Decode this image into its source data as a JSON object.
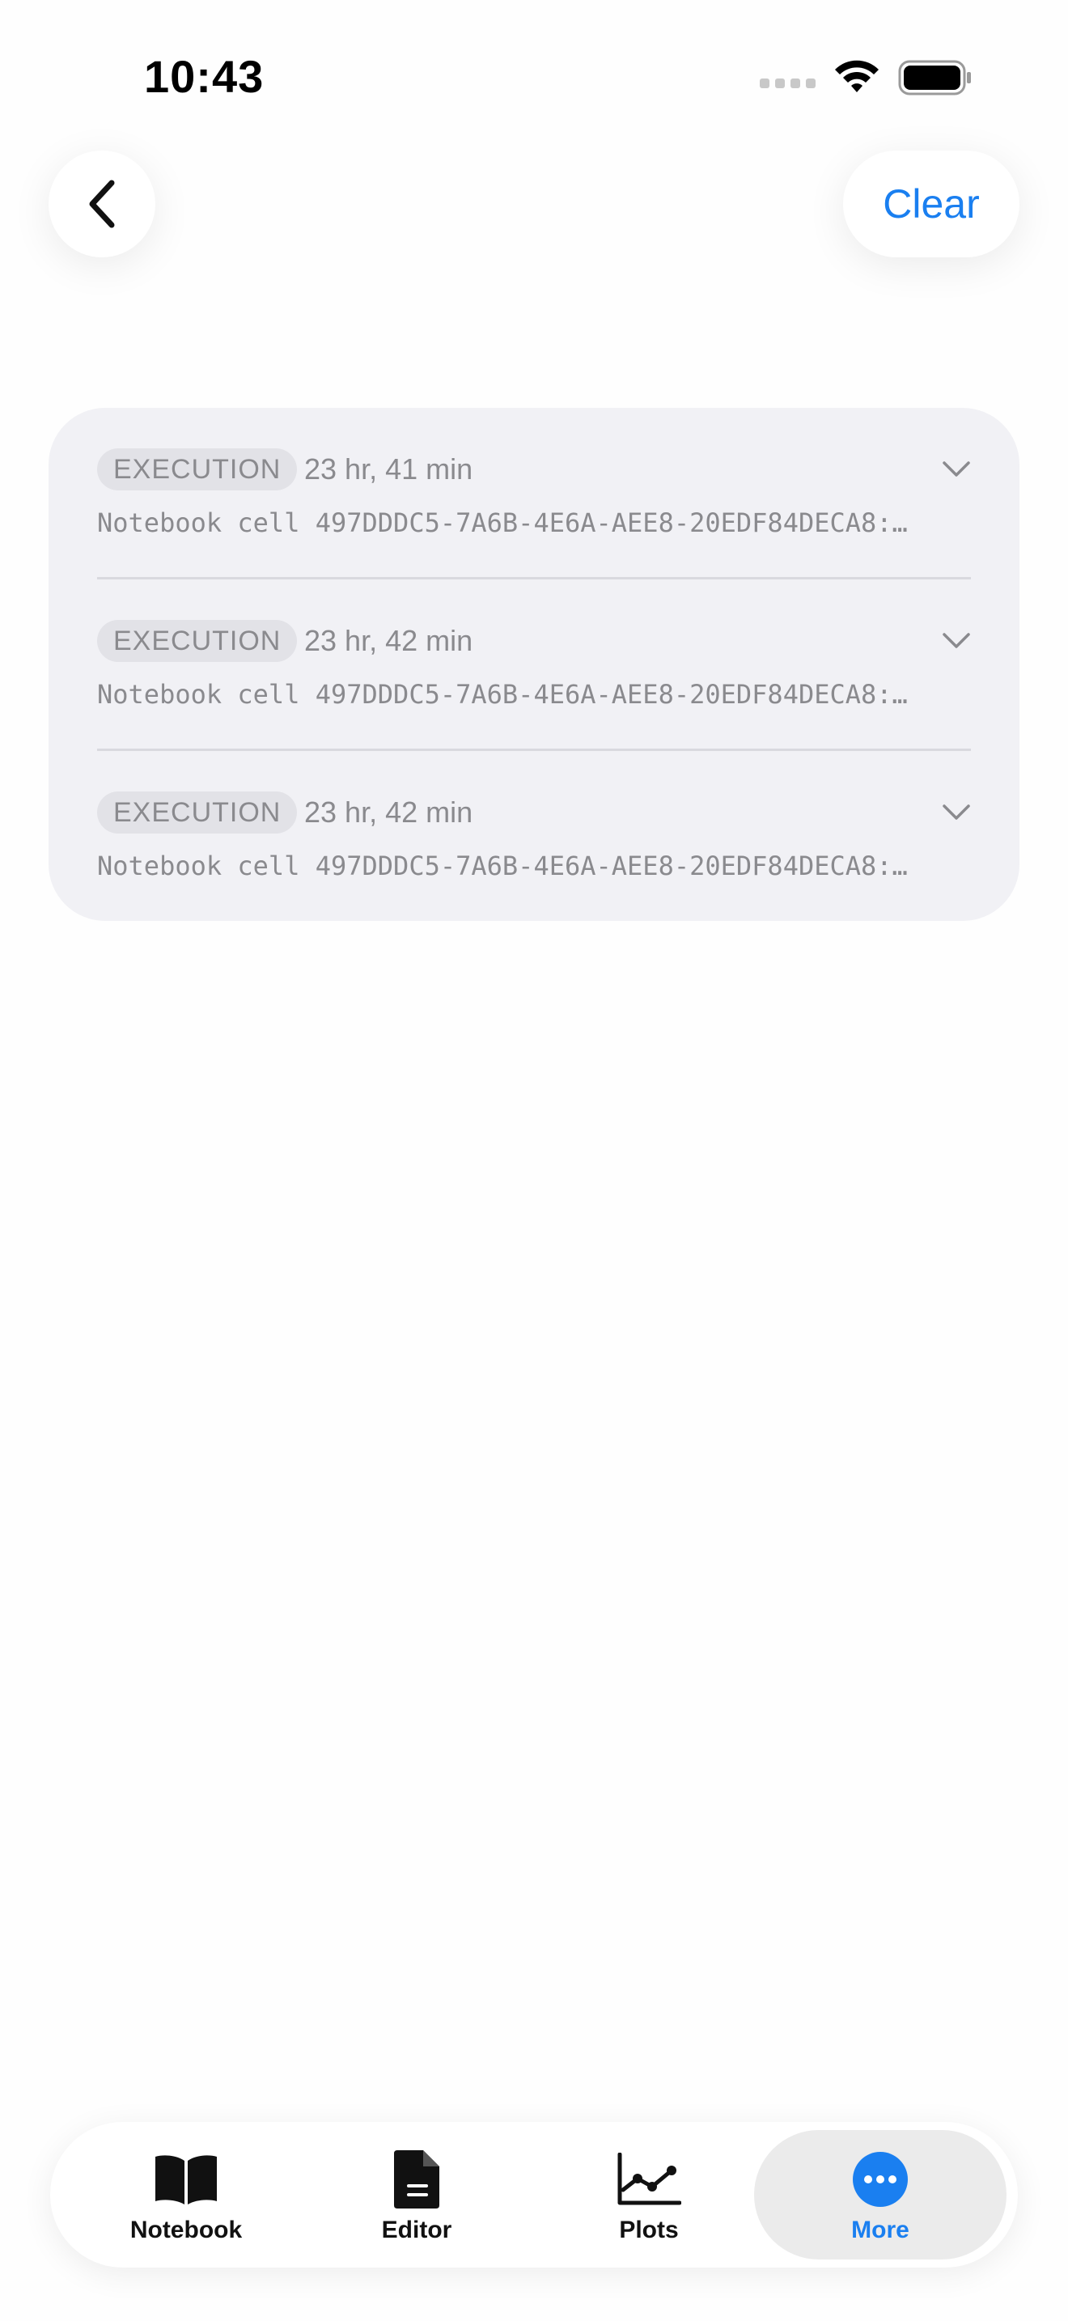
{
  "status_bar": {
    "time": "10:43"
  },
  "nav": {
    "back_icon": "chevron-left-icon",
    "clear_label": "Clear"
  },
  "log": {
    "entries": [
      {
        "type": "EXECUTION",
        "time": "23 hr, 41 min",
        "message": "Notebook cell 497DDDC5-7A6B-4E6A-AEE8-20EDF84DECA8:…"
      },
      {
        "type": "EXECUTION",
        "time": "23 hr, 42 min",
        "message": "Notebook cell 497DDDC5-7A6B-4E6A-AEE8-20EDF84DECA8:…"
      },
      {
        "type": "EXECUTION",
        "time": "23 hr, 42 min",
        "message": "Notebook cell 497DDDC5-7A6B-4E6A-AEE8-20EDF84DECA8:…"
      }
    ]
  },
  "tab_bar": {
    "tabs": [
      {
        "label": "Notebook",
        "icon": "book-icon",
        "active": false
      },
      {
        "label": "Editor",
        "icon": "document-icon",
        "active": false
      },
      {
        "label": "Plots",
        "icon": "line-chart-icon",
        "active": false
      },
      {
        "label": "More",
        "icon": "ellipsis-circle-icon",
        "active": true
      }
    ]
  },
  "colors": {
    "accent": "#1a7ff0",
    "card_background": "#f1f1f5",
    "secondary_text": "#8a8a8e"
  }
}
